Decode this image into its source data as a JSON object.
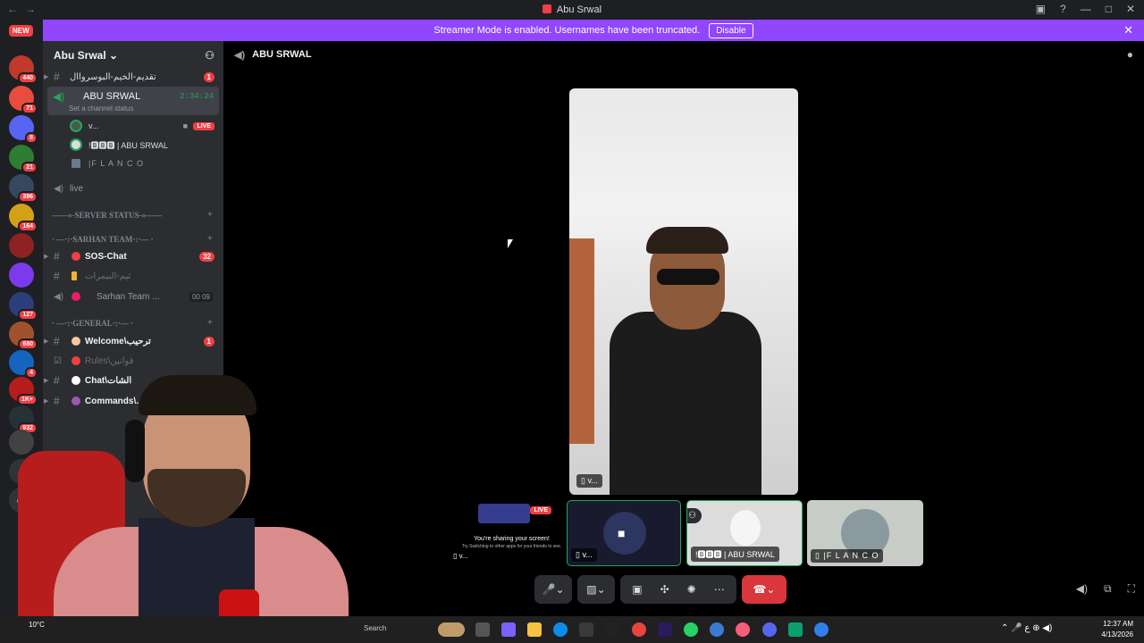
{
  "window": {
    "title": "Abu Srwal"
  },
  "banner": {
    "text": "Streamer Mode is enabled. Usernames have been truncated.",
    "button": "Disable"
  },
  "guilds": {
    "new_label": "NEW",
    "badges": [
      "85",
      "440",
      "71",
      "8",
      "21",
      "396",
      "164",
      "127",
      "680",
      "4",
      "1K+",
      "932"
    ]
  },
  "server": {
    "name": "Abu Srwal"
  },
  "channels": {
    "top_channel": "تقديم-الخيم-البوسرواال",
    "top_count": "1",
    "voice": {
      "name": "ABU SRWAL",
      "time": "2:34:24",
      "status": "Set a channel status"
    },
    "users": [
      {
        "name": "v...",
        "live": "LIVE"
      },
      {
        "name": "!🅱🅱🅱 | ABU SRWAL"
      },
      {
        "name": "|F L A N C O"
      }
    ],
    "live_channel": "live",
    "cat_server_status": "——«-SERVER STATUS-»——",
    "cat_sarhan": "· —·:·SARHAN TEAM·:·— ·",
    "sos": {
      "name": "SOS-Chat",
      "count": "32"
    },
    "team": "ثيم-البيمرات",
    "sarhan_vc": {
      "name": "Sarhan Team ...",
      "a": "00",
      "b": "09"
    },
    "cat_general": "· —·:·GENERAL·:·— ·",
    "welcome": {
      "name": "Welcome\\ترحيب",
      "count": "1"
    },
    "rules": "Rules\\قوانين",
    "chat": "Chat\\الشات",
    "commands": "Commands\\..."
  },
  "header": {
    "channel": "ABU SRWAL"
  },
  "stage": {
    "main_tag": "v...",
    "sharing_live": "LIVE",
    "sharing_text": "You're sharing your screen!",
    "sharing_sub": "Try Switching to other apps for your friends to see.",
    "sharing_tag": "v...",
    "tiles": [
      {
        "tag": "v..."
      },
      {
        "tag": "!🅱🅱🅱 | ABU SRWAL"
      },
      {
        "tag": "|F L A N C O"
      }
    ]
  },
  "taskbar": {
    "search": "Search",
    "time": "12:37 AM",
    "date": "4/13/2026",
    "weather": "10°C"
  }
}
